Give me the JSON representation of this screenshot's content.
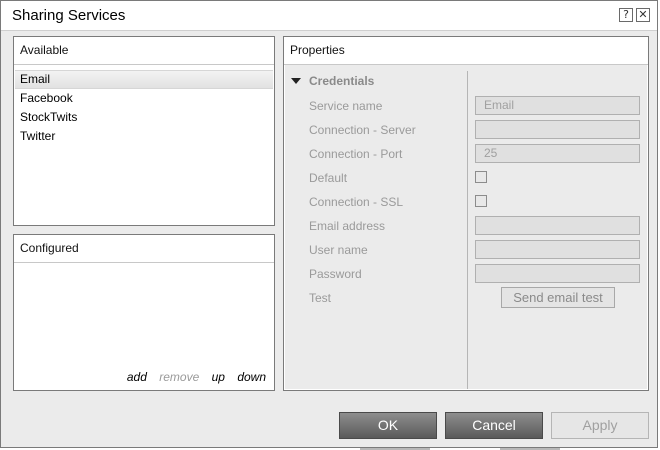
{
  "window": {
    "title": "Sharing Services",
    "help_label": "?",
    "close_label": "✕"
  },
  "available": {
    "header": "Available",
    "items": [
      "Email",
      "Facebook",
      "StockTwits",
      "Twitter"
    ],
    "selected": "Email"
  },
  "configured": {
    "header": "Configured",
    "actions": {
      "add": "add",
      "remove": "remove",
      "up": "up",
      "down": "down"
    }
  },
  "properties": {
    "header": "Properties",
    "section": "Credentials",
    "service_name": {
      "label": "Service name",
      "value": "Email"
    },
    "connection_server": {
      "label": "Connection - Server",
      "value": ""
    },
    "connection_port": {
      "label": "Connection - Port",
      "value": "25"
    },
    "default": {
      "label": "Default",
      "checked": false
    },
    "connection_ssl": {
      "label": "Connection - SSL",
      "checked": false
    },
    "email_address": {
      "label": "Email address",
      "value": ""
    },
    "user_name": {
      "label": "User name",
      "value": ""
    },
    "password": {
      "label": "Password",
      "value": ""
    },
    "test": {
      "label": "Test",
      "button": "Send email test"
    }
  },
  "footer": {
    "ok": "OK",
    "cancel": "Cancel",
    "apply": "Apply"
  },
  "colors": {
    "dialog_bg": "#ebebeb",
    "button_dark": "#6e6e6e",
    "disabled_text": "#9a9a9a"
  }
}
